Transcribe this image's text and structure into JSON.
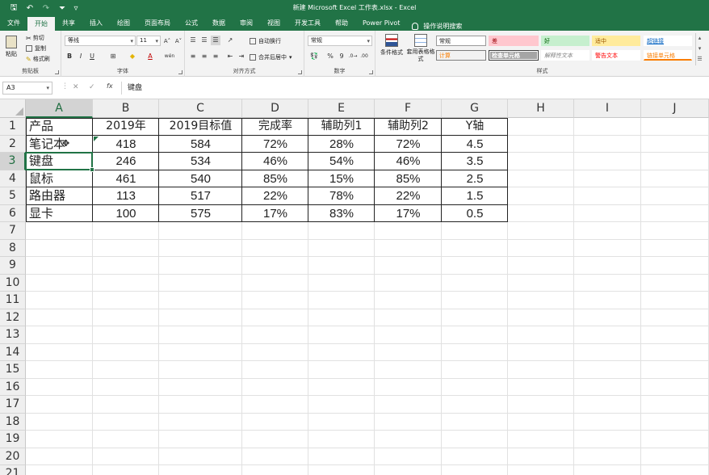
{
  "titlebar": {
    "title": "新建 Microsoft Excel 工作表.xlsx  -  Excel",
    "qa_save": "🖫",
    "qa_undo": "↶",
    "qa_redo": "↷",
    "qa_filter": "⏷",
    "qa_more": "▿",
    "bg_color": "#217346"
  },
  "tabs": [
    {
      "label": "文件",
      "active": false
    },
    {
      "label": "开始",
      "active": true
    },
    {
      "label": "共享",
      "active": false
    },
    {
      "label": "插入",
      "active": false
    },
    {
      "label": "绘图",
      "active": false
    },
    {
      "label": "页面布局",
      "active": false
    },
    {
      "label": "公式",
      "active": false
    },
    {
      "label": "数据",
      "active": false
    },
    {
      "label": "审阅",
      "active": false
    },
    {
      "label": "视图",
      "active": false
    },
    {
      "label": "开发工具",
      "active": false
    },
    {
      "label": "帮助",
      "active": false
    },
    {
      "label": "Power Pivot",
      "active": false
    }
  ],
  "tell_me": "操作说明搜索",
  "ribbon": {
    "clipboard": {
      "label": "剪贴板",
      "paste": "粘贴",
      "cut": "剪切",
      "copy": "复制",
      "format_painter": "格式刷"
    },
    "font": {
      "label": "字体",
      "font_name": "等线",
      "font_size": "11",
      "bold": "B",
      "italic": "I",
      "underline": "U",
      "grow": "A˄",
      "shrink": "A˅",
      "font_color_letter": "A",
      "fill_letter": "◆",
      "borders": "⊞",
      "wen": "wén"
    },
    "alignment": {
      "label": "对齐方式",
      "wrap": "自动换行",
      "merge": "合并后居中"
    },
    "number": {
      "label": "数字",
      "format": "常规",
      "percent": "%",
      "comma": "9",
      "currency": "₊"
    },
    "styles": {
      "label": "样式",
      "conditional": "条件格式",
      "table_format": "套用表格格式",
      "cells": [
        {
          "text": "常规",
          "bg": "#ffffff",
          "fg": "#222222",
          "border": "#999999"
        },
        {
          "text": "差",
          "bg": "#ffc7ce",
          "fg": "#9c0006",
          "border": "#ffc7ce"
        },
        {
          "text": "好",
          "bg": "#c6efce",
          "fg": "#006100",
          "border": "#c6efce"
        },
        {
          "text": "适中",
          "bg": "#ffeb9c",
          "fg": "#9c5700",
          "border": "#ffeb9c"
        },
        {
          "text": "超链接",
          "bg": "#ffffff",
          "fg": "#0563c1",
          "border": "#ffffff"
        },
        {
          "text": "计算",
          "bg": "#f2f2f2",
          "fg": "#fa7d00",
          "border": "#7f7f7f"
        },
        {
          "text": "检查单元格",
          "bg": "#a5a5a5",
          "fg": "#ffffff",
          "border": "#3f3f3f"
        },
        {
          "text": "解释性文本",
          "bg": "#ffffff",
          "fg": "#7f7f7f",
          "border": "#ffffff"
        },
        {
          "text": "警告文本",
          "bg": "#ffffff",
          "fg": "#ff0000",
          "border": "#ffffff"
        },
        {
          "text": "链接单元格",
          "bg": "#ffffff",
          "fg": "#fa7d00",
          "border": "#ffffff"
        }
      ]
    }
  },
  "formula_bar": {
    "name_box": "A3",
    "cancel": "✕",
    "enter": "✓",
    "fx": "fx",
    "content": "键盘"
  },
  "grid": {
    "columns": [
      "A",
      "B",
      "C",
      "D",
      "E",
      "F",
      "G",
      "H",
      "I",
      "J"
    ],
    "rows": [
      "1",
      "2",
      "3",
      "4",
      "5",
      "6",
      "7",
      "8",
      "9",
      "10",
      "11",
      "12",
      "13",
      "14",
      "15",
      "16",
      "17",
      "18",
      "19",
      "20",
      "21"
    ],
    "selected_col": "A",
    "selected_row": "3",
    "accent": "#217346"
  },
  "table": {
    "header": [
      "产品",
      "2019年",
      "2019目标值",
      "完成率",
      "辅助列1",
      "辅助列2",
      "Y轴"
    ],
    "rows": [
      [
        "笔记本",
        "418",
        "584",
        "72%",
        "28%",
        "72%",
        "4.5"
      ],
      [
        "键盘",
        "246",
        "534",
        "46%",
        "54%",
        "46%",
        "3.5"
      ],
      [
        "鼠标",
        "461",
        "540",
        "85%",
        "15%",
        "85%",
        "2.5"
      ],
      [
        "路由器",
        "113",
        "517",
        "22%",
        "78%",
        "22%",
        "1.5"
      ],
      [
        "显卡",
        "100",
        "575",
        "17%",
        "83%",
        "17%",
        "0.5"
      ]
    ]
  }
}
